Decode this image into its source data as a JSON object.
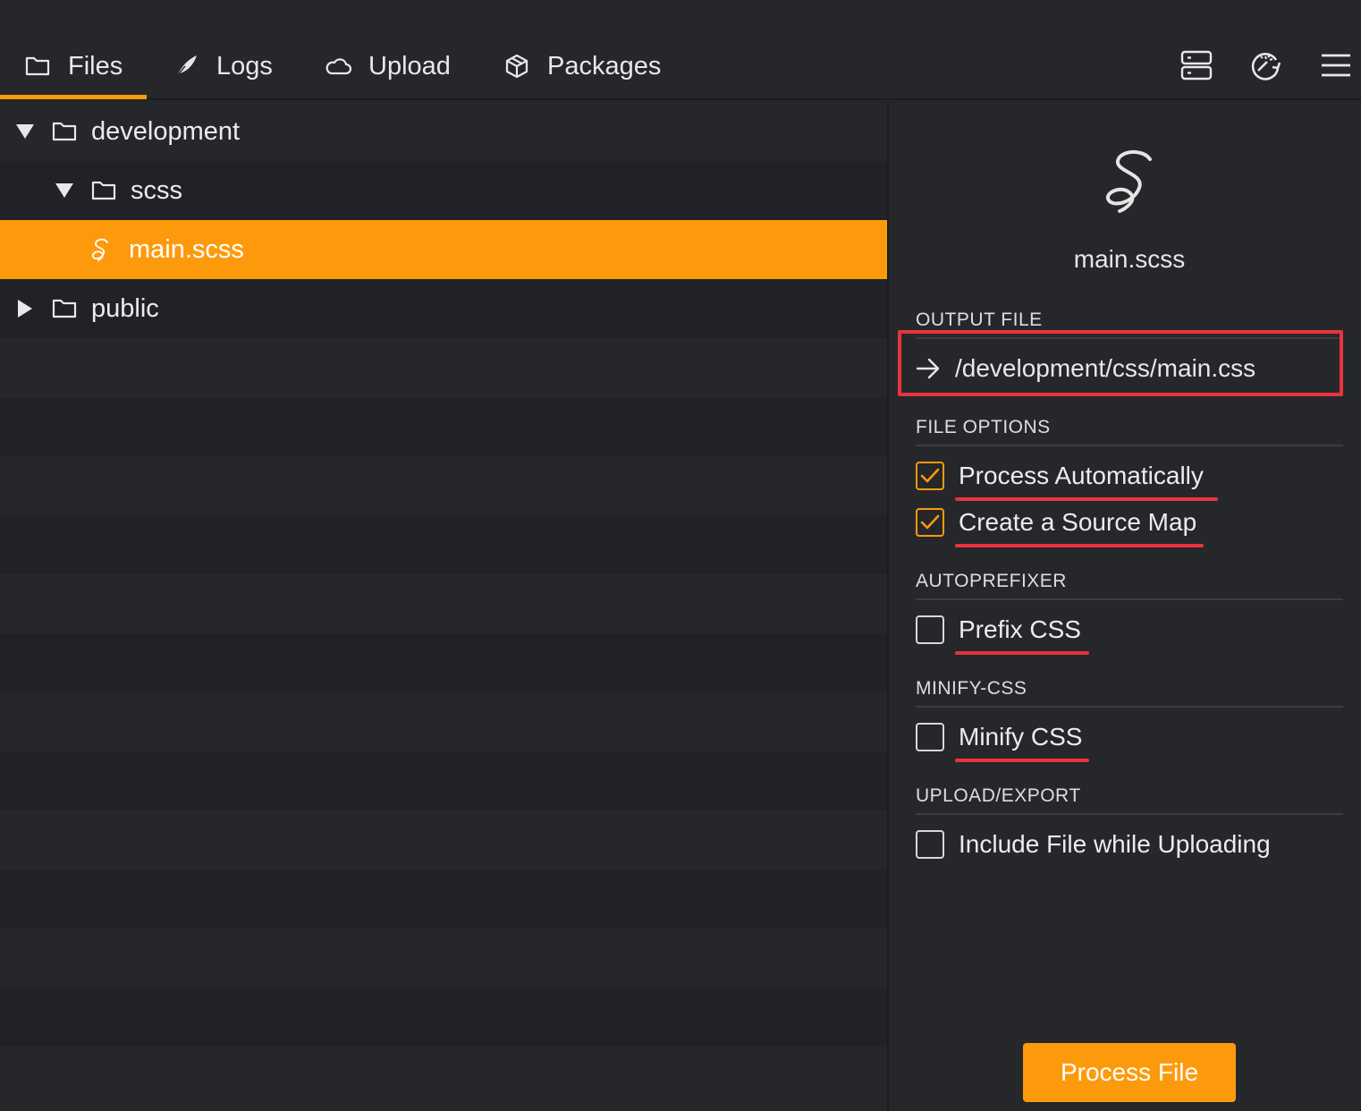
{
  "tabs": [
    {
      "label": "Files",
      "icon": "folder-icon",
      "active": true
    },
    {
      "label": "Logs",
      "icon": "feather-icon",
      "active": false
    },
    {
      "label": "Upload",
      "icon": "cloud-icon",
      "active": false
    },
    {
      "label": "Packages",
      "icon": "package-icon",
      "active": false
    }
  ],
  "toolbar": {
    "icons": [
      "server-icon",
      "refresh-build-icon",
      "menu-icon"
    ]
  },
  "tree": [
    {
      "label": "development",
      "type": "folder",
      "expanded": true
    },
    {
      "label": "scss",
      "type": "folder",
      "expanded": true
    },
    {
      "label": "main.scss",
      "type": "file",
      "selected": true,
      "icon": "sass-icon"
    },
    {
      "label": "public",
      "type": "folder",
      "expanded": false
    }
  ],
  "inspector": {
    "file_icon": "sass-logo-icon",
    "file_name": "main.scss",
    "output_title": "OUTPUT FILE",
    "output_path": "/development/css/main.css",
    "file_options_title": "FILE OPTIONS",
    "process_auto": {
      "label": "Process Automatically",
      "checked": true
    },
    "source_map": {
      "label": "Create a Source Map",
      "checked": true
    },
    "autoprefixer_title": "AUTOPREFIXER",
    "prefix_css": {
      "label": "Prefix CSS",
      "checked": false
    },
    "minify_title": "MINIFY-CSS",
    "minify_css": {
      "label": "Minify CSS",
      "checked": false
    },
    "upload_title": "UPLOAD/EXPORT",
    "include_upload": {
      "label": "Include File while Uploading",
      "checked": false
    },
    "process_button": "Process File"
  },
  "colors": {
    "accent": "#fd9a0c",
    "annotation_red": "#e8333d",
    "background": "#26272b"
  }
}
